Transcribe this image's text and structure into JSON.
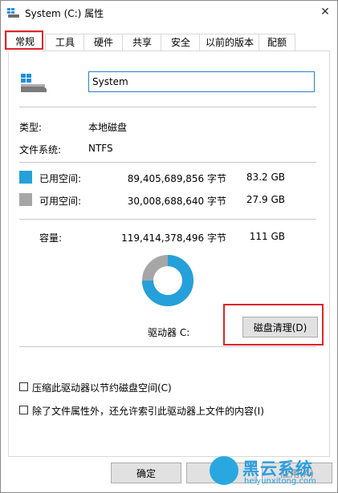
{
  "window": {
    "title": "System (C:) 属性",
    "close_glyph": "✕",
    "title_icon": "drive-icon"
  },
  "tabs": [
    {
      "label": "常规",
      "active": true
    },
    {
      "label": "工具"
    },
    {
      "label": "硬件"
    },
    {
      "label": "共享"
    },
    {
      "label": "安全"
    },
    {
      "label": "以前的版本"
    },
    {
      "label": "配额"
    }
  ],
  "general": {
    "drive_name": "System",
    "type_label": "类型:",
    "type_value": "本地磁盘",
    "fs_label": "文件系统:",
    "fs_value": "NTFS",
    "used": {
      "label": "已用空间:",
      "bytes": "89,405,689,856 字节",
      "size": "83.2 GB",
      "color": "#26a0da"
    },
    "free": {
      "label": "可用空间:",
      "bytes": "30,008,688,640 字节",
      "size": "27.9 GB",
      "color": "#a6a6a6"
    },
    "capacity": {
      "label": "容量:",
      "bytes": "119,414,378,496 字节",
      "size": "111 GB"
    },
    "used_fraction": 0.7487,
    "drive_label": "驱动器 C:",
    "cleanup_button": "磁盘清理(D)",
    "compress_checkbox": "压缩此驱动器以节约磁盘空间(C)",
    "index_checkbox": "除了文件属性外，还允许索引此驱动器上文件的内容(I)"
  },
  "buttons": {
    "ok": "确定",
    "cancel": "取消",
    "apply": "应用(A)"
  },
  "watermark": {
    "brand": "黑云系统",
    "url": "heiyunxitong.com",
    "color": "#29a8e0"
  }
}
